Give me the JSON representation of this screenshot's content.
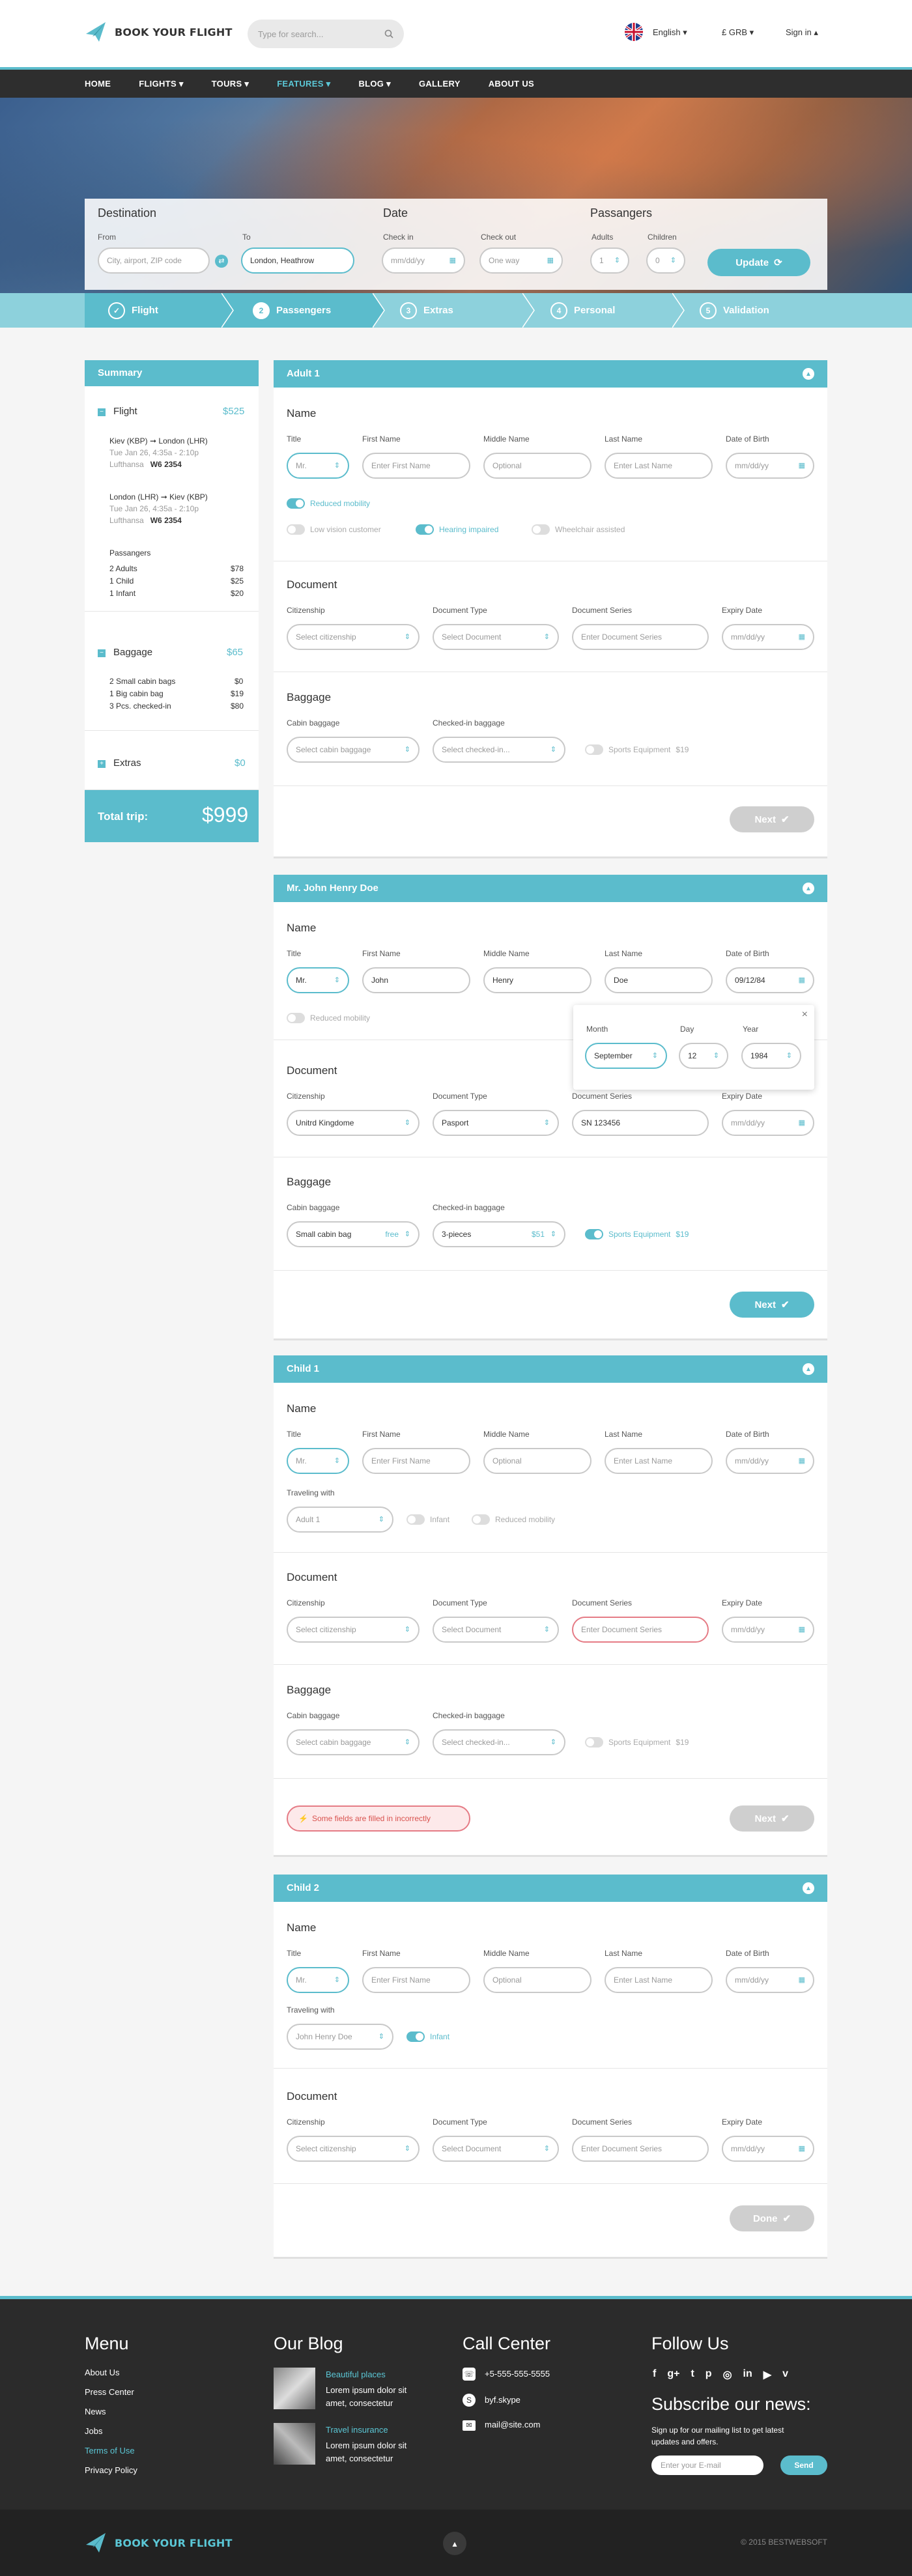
{
  "brand": {
    "name": "BOOK YOUR FLIGHT",
    "accent": "#5bbccc",
    "dark": "#2e2e2e"
  },
  "header": {
    "search_placeholder": "Type for search...",
    "language": "English",
    "currency": "£ GRB",
    "signin": "Sign in"
  },
  "nav": [
    "HOME",
    "FLIGHTS",
    "TOURS",
    "FEATURES",
    "BLOG",
    "GALLERY",
    "ABOUT US"
  ],
  "search": {
    "destination": "Destination",
    "from_label": "From",
    "from_placeholder": "City, airport, ZIP code",
    "to_label": "To",
    "to_value": "London, Heathrow",
    "date": "Date",
    "checkin_label": "Check in",
    "checkin_placeholder": "mm/dd/yy",
    "checkout_label": "Check out",
    "checkout_placeholder": "One way",
    "passengers": "Passangers",
    "adults_label": "Adults",
    "adults_value": "1",
    "children_label": "Children",
    "children_value": "0",
    "update": "Update"
  },
  "steps": [
    {
      "n": "",
      "label": "Flight"
    },
    {
      "n": "2",
      "label": "Passengers"
    },
    {
      "n": "3",
      "label": "Extras"
    },
    {
      "n": "4",
      "label": "Personal"
    },
    {
      "n": "5",
      "label": "Validation"
    }
  ],
  "summary": {
    "title": "Summary",
    "flight": "Flight",
    "flight_price": "$525",
    "leg1_route_from": "Kiev (KBP)",
    "leg1_route_to": "London (LHR)",
    "leg1_time": "Tue Jan 26,   4:35a - 2:10p",
    "leg1_airline": "Lufthansa",
    "leg1_code": "W6 2354",
    "leg2_route_from": "London (LHR)",
    "leg2_route_to": "Kiev (KBP)",
    "leg2_time": "Tue Jan 26,   4:35a - 2:10p",
    "leg2_airline": "Lufthansa",
    "leg2_code": "W6 2354",
    "pass_title": "Passangers",
    "pass": [
      {
        "l": "2 Adults",
        "p": "$78"
      },
      {
        "l": "1 Child",
        "p": "$25"
      },
      {
        "l": "1 Infant",
        "p": "$20"
      }
    ],
    "baggage": "Baggage",
    "baggage_price": "$65",
    "bags": [
      {
        "l": "2 Small cabin bags",
        "p": "$0"
      },
      {
        "l": "1 Big cabin bag",
        "p": "$19"
      },
      {
        "l": "3 Pcs. checked-in",
        "p": "$80"
      }
    ],
    "extras": "Extras",
    "extras_price": "$0",
    "total_label": "Total trip:",
    "total": "$999"
  },
  "labels": {
    "name": "Name",
    "title": "Title",
    "first": "First Name",
    "middle": "Middle Name",
    "last": "Last Name",
    "dob": "Date of Birth",
    "document": "Document",
    "citizenship": "Citizenship",
    "doctype": "Document Type",
    "docseries": "Document Series",
    "expiry": "Expiry Date",
    "baggage": "Baggage",
    "cabin": "Cabin baggage",
    "checked": "Checked-in baggage",
    "sports": "Sports Equipment",
    "sports_price": "$19",
    "traveling": "Traveling with",
    "infant": "Infant",
    "reduced": "Reduced mobility",
    "low_vision": "Low vision customer",
    "hearing": "Hearing impaired",
    "wheelchair": "Wheelchair assisted",
    "next": "Next",
    "done": "Done"
  },
  "ph": {
    "title": "Mr.",
    "first": "Enter First Name",
    "middle": "Optional",
    "last": "Enter Last Name",
    "date": "mm/dd/yy",
    "citizenship": "Select citizenship",
    "doctype": "Select Document",
    "docseries": "Enter Document Series",
    "cabin": "Select cabin baggage",
    "checked": "Select checked-in..."
  },
  "forms": {
    "adult1": {
      "header": "Adult 1"
    },
    "adult2": {
      "header": "Mr. John Henry Doe",
      "title": "Mr.",
      "first": "John",
      "middle": "Henry",
      "last": "Doe",
      "dob": "09/12/84",
      "month_label": "Month",
      "month": "September",
      "day_label": "Day",
      "day": "12",
      "year_label": "Year",
      "year": "1984",
      "citizenship": "Unitrd Kingdome",
      "doctype": "Pasport",
      "docseries": "SN 123456",
      "cabin": "Small cabin bag",
      "cabin_price": "free",
      "checked": "3-pieces",
      "checked_price": "$51"
    },
    "child1": {
      "header": "Child 1",
      "traveling": "Adult 1",
      "error": "Some fields are filled in incorrectly"
    },
    "child2": {
      "header": "Child 2",
      "traveling": "John Henry Doe"
    }
  },
  "footer": {
    "menu": "Menu",
    "menu_items": [
      "About Us",
      "Press Center",
      "News",
      "Jobs",
      "Terms of Use",
      "Privacy Policy"
    ],
    "blog": "Our Blog",
    "posts": [
      {
        "t": "Beautiful places",
        "d1": "Lorem ipsum dolor sit",
        "d2": "amet, consectetur"
      },
      {
        "t": "Travel insurance",
        "d1": "Lorem ipsum dolor sit",
        "d2": "amet, consectetur"
      }
    ],
    "call": "Call Center",
    "phone": "+5-555-555-5555",
    "skype": "byf.skype",
    "mail": "mail@site.com",
    "follow": "Follow Us",
    "subscribe": "Subscribe our news:",
    "sub_text1": "Sign up for our mailing list to get latest",
    "sub_text2": "updates and offers.",
    "email_placeholder": "Enter your E-mail",
    "send": "Send",
    "copyright": "© 2015 BESTWEBSOFT"
  }
}
